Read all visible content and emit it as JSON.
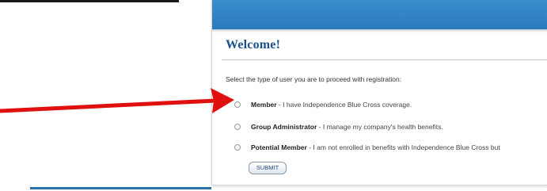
{
  "page": {
    "welcome_title": "Welcome!",
    "instruction": "Select the type of user you are to proceed with registration:",
    "options": [
      {
        "title": "Member",
        "separator": " - ",
        "description": "I have Independence Blue Cross coverage."
      },
      {
        "title": "Group Administrator",
        "separator": " - ",
        "description": "I manage my company's health benefits."
      },
      {
        "title": "Potential Member",
        "separator": " - ",
        "description": "I am not enrolled in benefits with Independence Blue Cross but"
      }
    ],
    "submit_label": "SUBMIT"
  },
  "colors": {
    "header_blue": "#2f86c8",
    "title_blue": "#1d4e8e",
    "arrow_red": "#e01010",
    "bottom_line_blue": "#2a6fa8"
  },
  "icons": {
    "annotation_arrow": "red-arrow-icon",
    "radio": "radio-button-unselected"
  }
}
